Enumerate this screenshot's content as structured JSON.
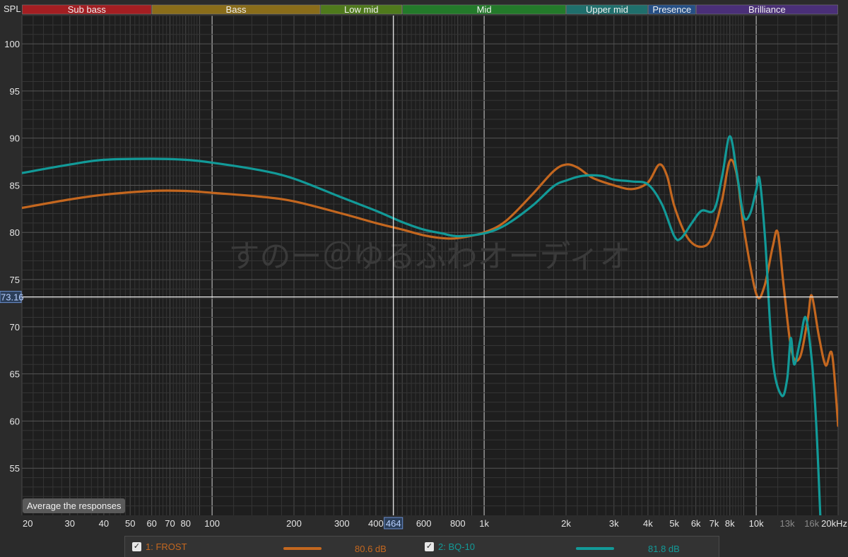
{
  "chart_data": {
    "type": "line",
    "ylabel": "SPL",
    "xscale": "log",
    "xlim": [
      20,
      20000
    ],
    "ylim": [
      50,
      103
    ],
    "yticks": [
      55,
      60,
      65,
      70,
      75,
      80,
      85,
      90,
      95,
      100
    ],
    "xticks": [
      {
        "v": 20,
        "t": "20"
      },
      {
        "v": 30,
        "t": "30"
      },
      {
        "v": 40,
        "t": "40"
      },
      {
        "v": 50,
        "t": "50"
      },
      {
        "v": 60,
        "t": "60"
      },
      {
        "v": 70,
        "t": "70"
      },
      {
        "v": 80,
        "t": "80"
      },
      {
        "v": 100,
        "t": "100"
      },
      {
        "v": 200,
        "t": "200"
      },
      {
        "v": 300,
        "t": "300"
      },
      {
        "v": 400,
        "t": "400"
      },
      {
        "v": 600,
        "t": "600"
      },
      {
        "v": 800,
        "t": "800"
      },
      {
        "v": 1000,
        "t": "1k"
      },
      {
        "v": 2000,
        "t": "2k"
      },
      {
        "v": 3000,
        "t": "3k"
      },
      {
        "v": 4000,
        "t": "4k"
      },
      {
        "v": 5000,
        "t": "5k"
      },
      {
        "v": 6000,
        "t": "6k"
      },
      {
        "v": 7000,
        "t": "7k"
      },
      {
        "v": 8000,
        "t": "8k"
      },
      {
        "v": 10000,
        "t": "10k"
      },
      {
        "v": 13000,
        "t": "13k",
        "dim": true
      },
      {
        "v": 16000,
        "t": "16k",
        "dim": true
      },
      {
        "v": 20000,
        "t": "20kHz"
      }
    ],
    "bands": [
      {
        "name": "Sub bass",
        "from": 20,
        "to": 60,
        "color": "#a41e22"
      },
      {
        "name": "Bass",
        "from": 60,
        "to": 250,
        "color": "#8a6d1a"
      },
      {
        "name": "Low mid",
        "from": 250,
        "to": 500,
        "color": "#4f7a1c"
      },
      {
        "name": "Mid",
        "from": 500,
        "to": 2000,
        "color": "#237a2a"
      },
      {
        "name": "Upper mid",
        "from": 2000,
        "to": 4000,
        "color": "#1f6f6c"
      },
      {
        "name": "Presence",
        "from": 4000,
        "to": 6000,
        "color": "#254f86"
      },
      {
        "name": "Brilliance",
        "from": 6000,
        "to": 20000,
        "color": "#4a2f78"
      }
    ],
    "cursor": {
      "x_label": "464",
      "y_label": "73.16",
      "x": 464,
      "y": 73.16
    },
    "watermark": "すのー＠ゆるふわオーディオ",
    "series": [
      {
        "name": "1: FROST",
        "color": "#c4671f",
        "avg": "80.6 dB",
        "points": [
          [
            20,
            82.6
          ],
          [
            30,
            83.5
          ],
          [
            40,
            84.0
          ],
          [
            60,
            84.4
          ],
          [
            80,
            84.4
          ],
          [
            100,
            84.2
          ],
          [
            150,
            83.8
          ],
          [
            200,
            83.3
          ],
          [
            300,
            82.0
          ],
          [
            400,
            81.0
          ],
          [
            500,
            80.3
          ],
          [
            600,
            79.7
          ],
          [
            700,
            79.4
          ],
          [
            800,
            79.4
          ],
          [
            1000,
            80.0
          ],
          [
            1200,
            81.2
          ],
          [
            1500,
            84.0
          ],
          [
            1800,
            86.5
          ],
          [
            2000,
            87.2
          ],
          [
            2200,
            86.9
          ],
          [
            2500,
            85.8
          ],
          [
            3000,
            85.0
          ],
          [
            3500,
            84.6
          ],
          [
            4000,
            85.3
          ],
          [
            4400,
            87.2
          ],
          [
            4700,
            86.0
          ],
          [
            5000,
            82.8
          ],
          [
            5500,
            79.8
          ],
          [
            6000,
            78.6
          ],
          [
            6600,
            78.7
          ],
          [
            7000,
            80.2
          ],
          [
            7500,
            83.5
          ],
          [
            8000,
            87.6
          ],
          [
            8500,
            86.0
          ],
          [
            9000,
            80.5
          ],
          [
            10000,
            73.5
          ],
          [
            10700,
            74.2
          ],
          [
            11500,
            78.5
          ],
          [
            12000,
            80.0
          ],
          [
            12600,
            74.5
          ],
          [
            13500,
            67.4
          ],
          [
            14500,
            66.8
          ],
          [
            15500,
            71.0
          ],
          [
            16000,
            73.3
          ],
          [
            17000,
            69.0
          ],
          [
            18000,
            65.9
          ],
          [
            19000,
            67.1
          ],
          [
            20000,
            59.5
          ]
        ]
      },
      {
        "name": "2: BQ-10",
        "color": "#129a98",
        "avg": "81.8 dB",
        "points": [
          [
            20,
            86.3
          ],
          [
            30,
            87.2
          ],
          [
            40,
            87.7
          ],
          [
            60,
            87.8
          ],
          [
            80,
            87.7
          ],
          [
            100,
            87.4
          ],
          [
            150,
            86.6
          ],
          [
            200,
            85.7
          ],
          [
            300,
            83.7
          ],
          [
            400,
            82.3
          ],
          [
            500,
            81.1
          ],
          [
            600,
            80.3
          ],
          [
            700,
            79.9
          ],
          [
            800,
            79.6
          ],
          [
            1000,
            79.9
          ],
          [
            1200,
            80.8
          ],
          [
            1500,
            82.8
          ],
          [
            1800,
            84.9
          ],
          [
            2000,
            85.5
          ],
          [
            2300,
            86.0
          ],
          [
            2700,
            86.0
          ],
          [
            3000,
            85.6
          ],
          [
            3500,
            85.4
          ],
          [
            4000,
            85.1
          ],
          [
            4500,
            83.0
          ],
          [
            5000,
            79.6
          ],
          [
            5300,
            79.4
          ],
          [
            5800,
            81.0
          ],
          [
            6300,
            82.3
          ],
          [
            7000,
            82.4
          ],
          [
            7500,
            86.0
          ],
          [
            8000,
            90.2
          ],
          [
            8500,
            86.2
          ],
          [
            9000,
            81.7
          ],
          [
            9500,
            82.0
          ],
          [
            10000,
            84.5
          ],
          [
            10300,
            85.6
          ],
          [
            10800,
            79.0
          ],
          [
            11500,
            66.5
          ],
          [
            12400,
            62.7
          ],
          [
            13000,
            64.5
          ],
          [
            13400,
            68.8
          ],
          [
            13800,
            66.0
          ],
          [
            14500,
            68.5
          ],
          [
            15200,
            71.0
          ],
          [
            16000,
            66.5
          ],
          [
            16600,
            60.0
          ],
          [
            17200,
            50.0
          ]
        ]
      }
    ]
  },
  "ui": {
    "average_button": "Average the responses",
    "legend": [
      {
        "check": "✓",
        "label": "1: FROST",
        "avg": "80.6 dB",
        "color": "#c4671f"
      },
      {
        "check": "✓",
        "label": "2: BQ-10",
        "avg": "81.8 dB",
        "color": "#129a98"
      }
    ]
  }
}
